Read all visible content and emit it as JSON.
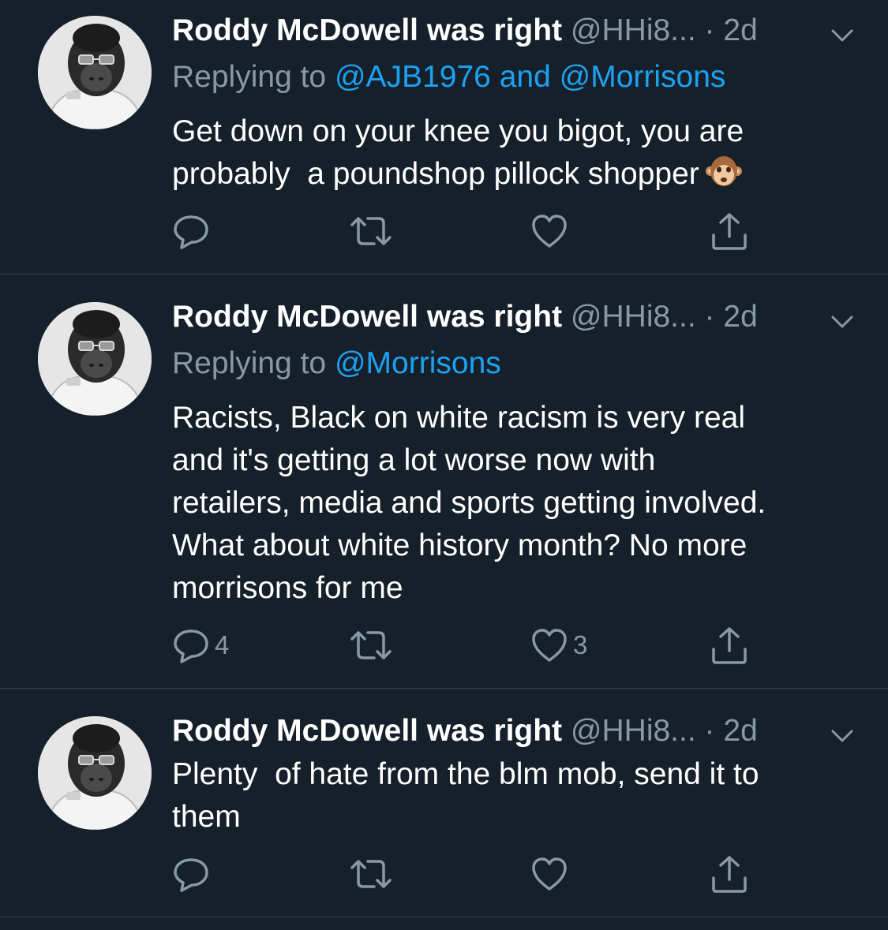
{
  "tweets": [
    {
      "display_name": "Roddy McDowell was right",
      "handle": "@HHi8...",
      "dot": "·",
      "time": "2d",
      "replying_prefix": "Replying to",
      "mentions": [
        "@AJB1976",
        "@Morrisons"
      ],
      "mention_joiner": "and",
      "text": "Get down on your knee you bigot, you are\nprobably  a poundshop pillock shopper",
      "emoji": "monkey-face",
      "reply_count": "",
      "retweet_count": "",
      "like_count": ""
    },
    {
      "display_name": "Roddy McDowell was right",
      "handle": "@HHi8...",
      "dot": "·",
      "time": "2d",
      "replying_prefix": "Replying to",
      "mentions": [
        "@Morrisons"
      ],
      "text": "Racists, Black on white racism is very real\nand it's getting a lot worse now with\nretailers, media and sports getting involved.\nWhat about white history month? No more\nmorrisons for me",
      "reply_count": "4",
      "retweet_count": "",
      "like_count": "3"
    },
    {
      "display_name": "Roddy McDowell was right",
      "handle": "@HHi8...",
      "dot": "·",
      "time": "2d",
      "text": "Plenty  of hate from the blm mob, send it to\nthem",
      "reply_count": "",
      "retweet_count": "",
      "like_count": ""
    }
  ],
  "colors": {
    "background": "#15202b",
    "text": "#ffffff",
    "secondary": "#8899a6",
    "link": "#1da1f2",
    "divider": "#38444d"
  },
  "icons": {
    "reply": "reply-bubble-icon",
    "retweet": "retweet-arrows-icon",
    "like": "heart-icon",
    "share": "share-upload-icon",
    "menu": "chevron-down-icon"
  }
}
